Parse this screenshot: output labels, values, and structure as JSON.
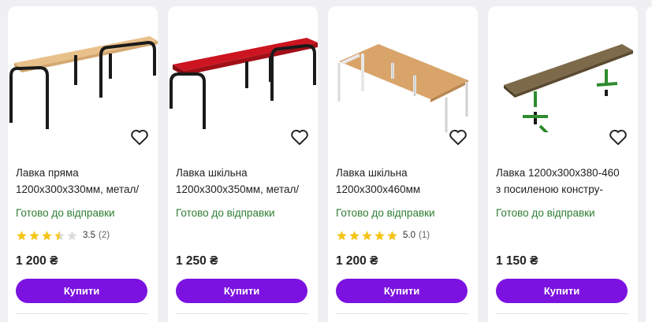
{
  "products": [
    {
      "title_line1": "Лавка пряма",
      "title_line2": "1200х300х330мм, метал/",
      "status": "Готово до відправки",
      "rating_value": "3.5",
      "rating_count": "(2)",
      "stars": 3.5,
      "price": "1 200 ₴",
      "buy_label": "Купити",
      "seat_color": "#e8c08a",
      "frame_color": "#1a1a1a"
    },
    {
      "title_line1": "Лавка шкільна",
      "title_line2": "1200х300х350мм, метал/",
      "status": "Готово до відправки",
      "price": "1 250 ₴",
      "buy_label": "Купити",
      "seat_color": "#cc1520",
      "frame_color": "#1a1a1a"
    },
    {
      "title_line1": "Лавка шкільна",
      "title_line2": "1200х300х460мм",
      "status": "Готово до відправки",
      "rating_value": "5.0",
      "rating_count": "(1)",
      "stars": 5,
      "price": "1 200 ₴",
      "buy_label": "Купити",
      "seat_color": "#d9a46a",
      "frame_color": "#f4f4f4"
    },
    {
      "title_line1": "Лавка 1200х300х380-460",
      "title_line2": "з посиленою констру-",
      "status": "Готово до відправки",
      "price": "1 150 ₴",
      "buy_label": "Купити",
      "seat_color": "#7d6a4a",
      "frame_color": "#2e8b2e"
    }
  ],
  "colors": {
    "accent": "#7b12e0",
    "status_green": "#2e7d32",
    "star": "#f5c518"
  }
}
